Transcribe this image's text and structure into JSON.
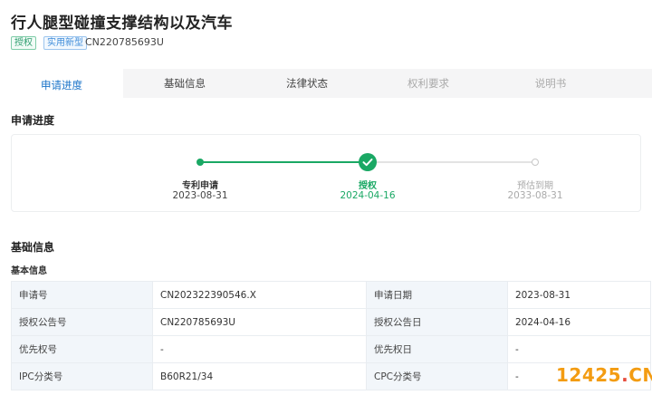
{
  "header": {
    "title": "行人腿型碰撞支撑结构以及汽车",
    "tags": [
      "授权",
      "实用新型"
    ],
    "pub_no": "CN220785693U"
  },
  "tabs": [
    {
      "label": "申请进度"
    },
    {
      "label": "基础信息"
    },
    {
      "label": "法律状态"
    },
    {
      "label": "权利要求"
    },
    {
      "label": "说明书"
    }
  ],
  "progress": {
    "section_title": "申请进度",
    "steps": [
      {
        "label": "专利申请",
        "date": "2023-08-31"
      },
      {
        "label": "授权",
        "date": "2024-04-16"
      },
      {
        "label": "预估到期",
        "date": "2033-08-31"
      }
    ]
  },
  "basic": {
    "section_title": "基础信息",
    "sub_title": "基本信息",
    "rows": [
      {
        "l1": "申请号",
        "v1": "CN202322390546.X",
        "l2": "申请日期",
        "v2": "2023-08-31"
      },
      {
        "l1": "授权公告号",
        "v1": "CN220785693U",
        "l2": "授权公告日",
        "v2": "2024-04-16"
      },
      {
        "l1": "优先权号",
        "v1": "-",
        "l2": "优先权日",
        "v2": "-"
      },
      {
        "l1": "IPC分类号",
        "v1": "B60R21/34",
        "l2": "CPC分类号",
        "v2": "-"
      }
    ]
  },
  "watermark": {
    "main": "12425",
    "tld": "CN"
  },
  "colors": {
    "accent": "#1a73c8",
    "success": "#1aa864",
    "label_bg": "#f2f6fa"
  }
}
